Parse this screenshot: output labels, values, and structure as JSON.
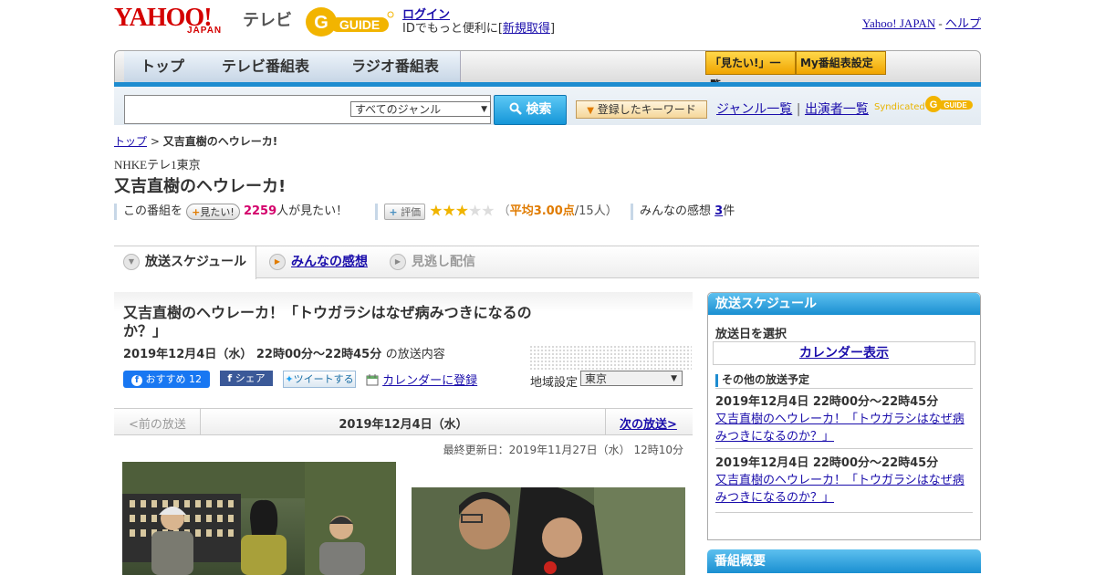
{
  "header": {
    "logo_yahoo": "YAHOO!",
    "logo_japan": "JAPAN",
    "logo_tv": "テレビ",
    "gguide_logo": "G-GUIDE",
    "login": "ログイン",
    "id_text_prefix": "IDでもっと便利に[",
    "signup": "新規取得",
    "id_text_suffix": "]",
    "yahoo_japan": "Yahoo! JAPAN",
    "sep": " - ",
    "help": "ヘルプ"
  },
  "nav": {
    "tabs": [
      "トップ",
      "テレビ番組表",
      "ラジオ番組表"
    ],
    "mitai_list": "「見たい!」一覧",
    "my_settings": "My番組表設定"
  },
  "search": {
    "genre": "すべてのジャンル",
    "button": "検索",
    "keyword_button": "登録したキーワード",
    "genre_list": "ジャンル一覧",
    "separator": " | ",
    "performer_list": "出演者一覧",
    "syndicated": "Syndicated"
  },
  "breadcrumb": {
    "top": "トップ",
    "sep": " > ",
    "current": "又吉直樹のヘウレーカ!"
  },
  "program": {
    "channel": "NHKEテレ1東京",
    "title": "又吉直樹のヘウレーカ!",
    "mitai_prefix": "この番組を",
    "mitai_btn": "見たい!",
    "mitai_count": "2259",
    "mitai_suffix": "人が見たい！",
    "hyoka_btn": "評価",
    "rating_stars": 3,
    "rating_open": "（",
    "rating_avg": "平均3.00点",
    "rating_count": "/15人）",
    "kanso_prefix": "みんなの感想",
    "kanso_count": "3",
    "kanso_suffix": "件"
  },
  "tabs": {
    "schedule": "放送スケジュール",
    "kanso": "みんなの感想",
    "minogashi": "見逃し配信"
  },
  "episode": {
    "title": "又吉直樹のヘウレーカ！「トウガラシはなぜ病みつきになるのか？」",
    "date": "2019年12月4日（水）",
    "time": "22時00分～22時45分",
    "date_suffix": "の放送内容",
    "fb_recommend": "おすすめ",
    "fb_count": "12",
    "fb_share": "シェア",
    "tweet": "ツイートする",
    "calendar_reg": "カレンダーに登録",
    "region_label": "地域設定",
    "region": "東京",
    "prev": "<前の放送",
    "current_date": "2019年12月4日（水）",
    "next": "次の放送>",
    "updated": "最終更新日：2019年11月27日（水） 12時10分"
  },
  "sidebar": {
    "schedule_title": "放送スケジュール",
    "select_date": "放送日を選択",
    "calendar_view": "カレンダー表示",
    "other_title": "その他の放送予定",
    "items": [
      {
        "datetime": "2019年12月4日 22時00分～22時45分",
        "link": "又吉直樹のヘウレーカ！「トウガラシはなぜ病みつきになるのか？」"
      },
      {
        "datetime": "2019年12月4日 22時00分～22時45分",
        "link": "又吉直樹のヘウレーカ！「トウガラシはなぜ病みつきになるのか？」"
      }
    ],
    "overview_title": "番組概要"
  },
  "colors": {
    "brand_red": "#d40000",
    "accent_blue": "#1e8cd0",
    "star": "#f0b400",
    "mitai_count": "#d4006b",
    "rating": "#e07b00"
  }
}
